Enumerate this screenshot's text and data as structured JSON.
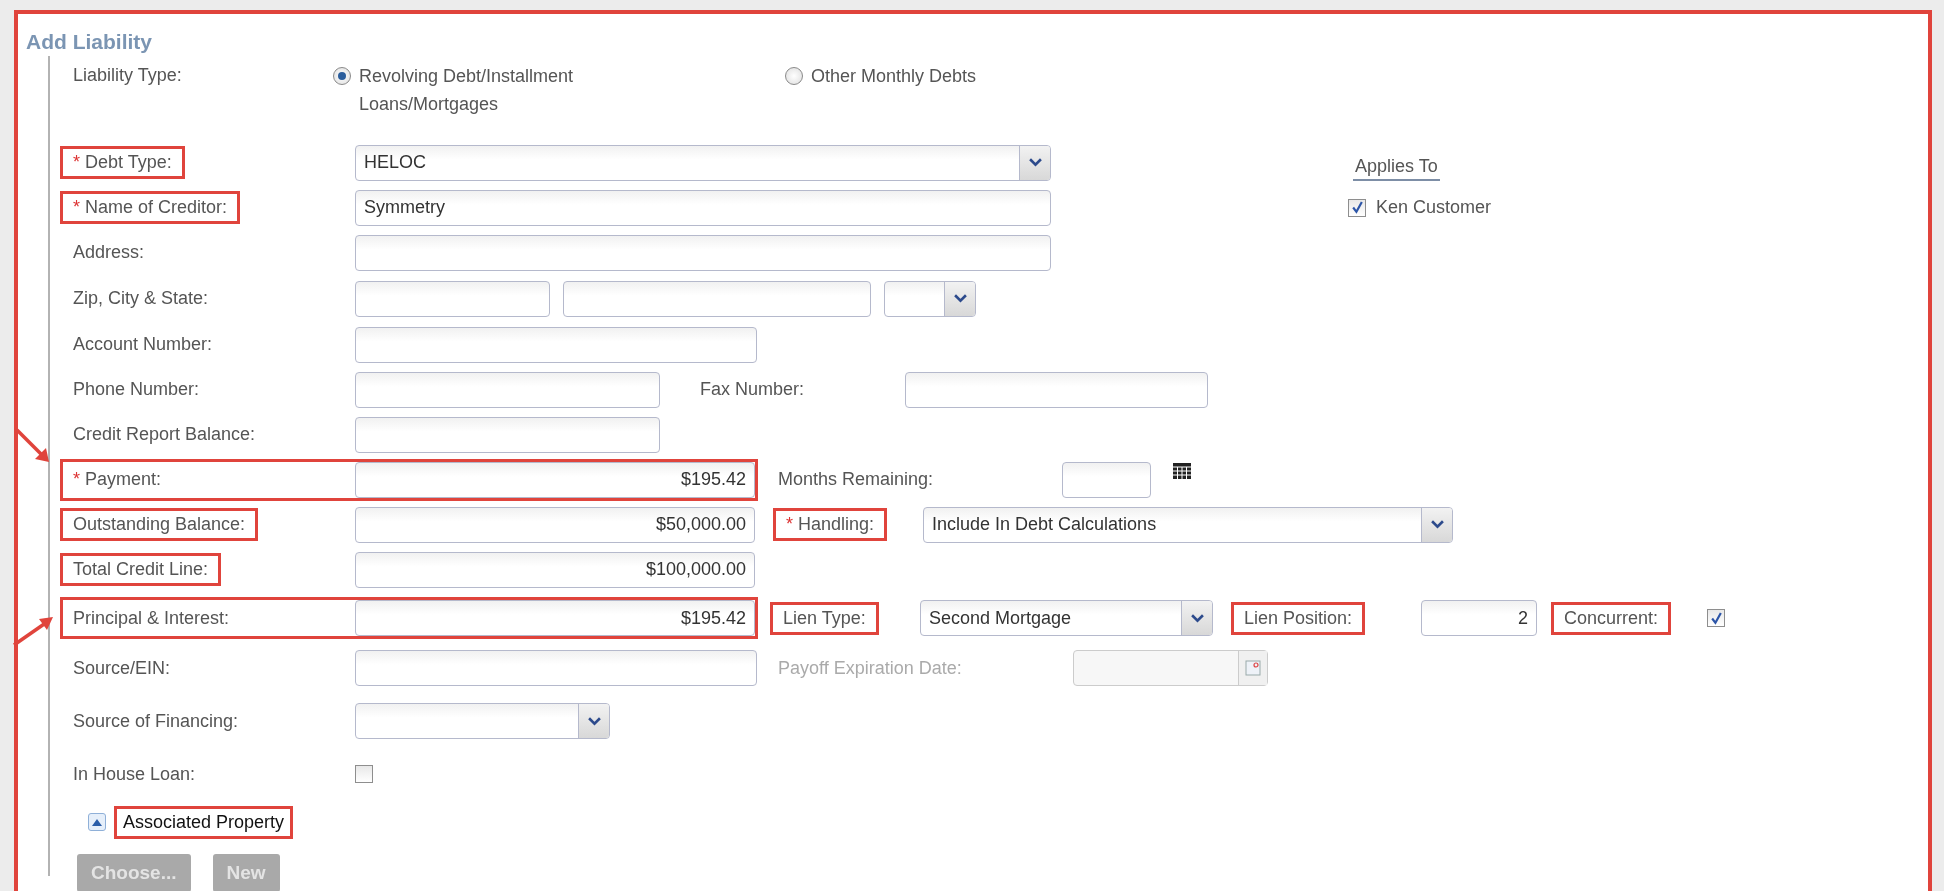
{
  "title": "Add Liability",
  "liability_type": {
    "label": "Liability Type:",
    "options": [
      {
        "label": "Revolving Debt/Installment Loans/Mortgages",
        "selected": true
      },
      {
        "label": "Other Monthly Debts",
        "selected": false
      }
    ]
  },
  "debt_type": {
    "marker": "*",
    "label": "Debt Type:",
    "highlighted": true,
    "value": "HELOC"
  },
  "name_of_creditor": {
    "marker": "*",
    "label": "Name of Creditor:",
    "highlighted": true,
    "value": "Symmetry"
  },
  "address": {
    "label": "Address:"
  },
  "zip_city_state": {
    "label": "Zip, City & State:"
  },
  "account_number": {
    "label": "Account Number:"
  },
  "phone_number": {
    "label": "Phone Number:"
  },
  "fax_number": {
    "label": "Fax Number:"
  },
  "credit_report_balance": {
    "label": "Credit Report Balance:"
  },
  "payment": {
    "marker": "*",
    "label": "Payment:",
    "highlighted": true,
    "highlight_includes_field": true,
    "arrow": true,
    "arrow_from_below": false,
    "value": "$195.42"
  },
  "months_remaining": {
    "label": "Months Remaining:"
  },
  "outstanding_balance": {
    "label": "Outstanding Balance:",
    "highlighted": true,
    "value": "$50,000.00"
  },
  "handling": {
    "marker": "*",
    "label": "Handling:",
    "highlighted": true,
    "value": "Include In Debt Calculations"
  },
  "total_credit_line": {
    "label": "Total Credit Line:",
    "highlighted": true,
    "value": "$100,000.00"
  },
  "principal_interest": {
    "label": "Principal & Interest:",
    "highlighted": true,
    "highlight_includes_field": true,
    "arrow": true,
    "arrow_from_below": true,
    "value": "$195.42"
  },
  "lien_type": {
    "label": "Lien Type:",
    "highlighted": true,
    "value": "Second Mortgage"
  },
  "lien_position": {
    "label": "Lien Position:",
    "highlighted": true,
    "value": "2"
  },
  "concurrent": {
    "label": "Concurrent:",
    "highlighted": true,
    "checked": true
  },
  "source_ein": {
    "label": "Source/EIN:"
  },
  "payoff_expiration_date": {
    "label": "Payoff Expiration Date:",
    "disabled": true
  },
  "source_of_financing": {
    "label": "Source of Financing:"
  },
  "in_house_loan": {
    "label": "In House Loan:",
    "checked": false
  },
  "associated_property": {
    "label": "Associated Property",
    "highlighted": true,
    "expanded": true
  },
  "buttons": [
    {
      "label": "Choose...",
      "disabled": true
    },
    {
      "label": "New",
      "disabled": true
    }
  ],
  "applies_to": {
    "title": "Applies To",
    "borrowers": [
      {
        "name": "Ken Customer",
        "checked": true
      }
    ]
  }
}
